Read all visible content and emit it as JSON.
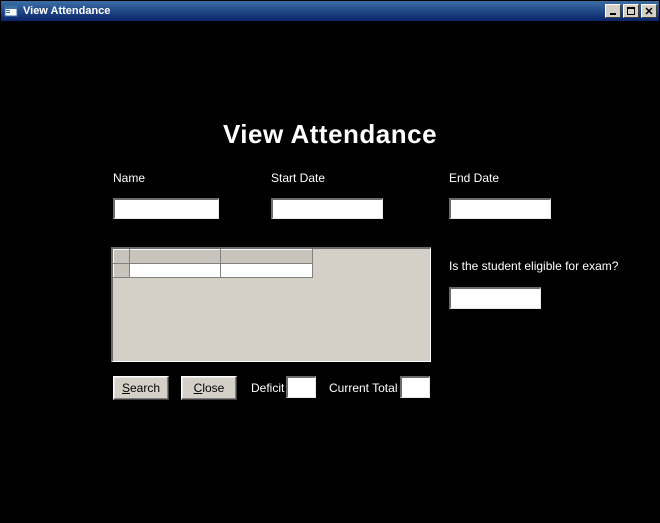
{
  "window": {
    "title": "View Attendance"
  },
  "header": {
    "title": "View Attendance"
  },
  "labels": {
    "name": "Name",
    "start_date": "Start Date",
    "end_date": "End Date",
    "eligible_q": "Is the student eligible for exam?",
    "deficit": "Deficit",
    "current_total": "Current Total"
  },
  "inputs": {
    "name": "",
    "start_date": "",
    "end_date": "",
    "eligible": "",
    "deficit": "",
    "current_total": ""
  },
  "buttons": {
    "search": "Search",
    "close": "Close"
  },
  "grid": {
    "headers": [
      "",
      ""
    ],
    "rows": [
      [
        "",
        ""
      ]
    ]
  }
}
